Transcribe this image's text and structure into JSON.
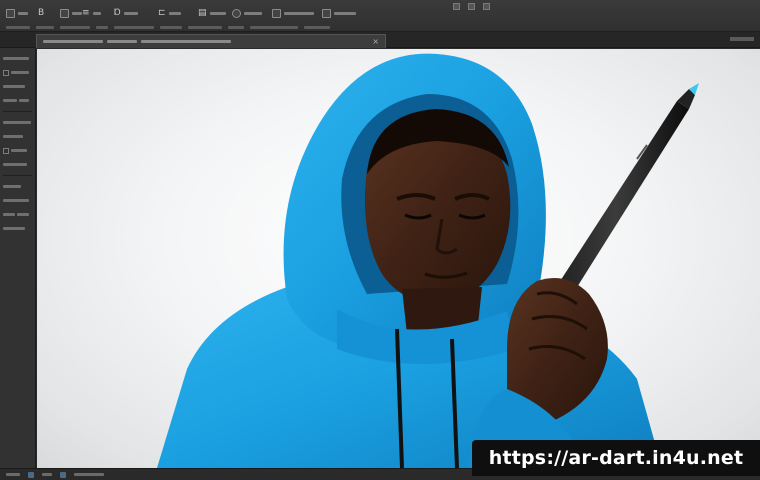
{
  "app": {
    "name": "image-editor",
    "accent": "#4a6a8a",
    "chrome_dark": "#2b2b2b",
    "canvas_bg": "#f2f3f4"
  },
  "menubar": {
    "tools": [
      {
        "icon": "square-dot-icon",
        "glyph": "◦"
      },
      {
        "icon": "bold-b-icon",
        "glyph": "B"
      },
      {
        "icon": "transform-icon",
        "glyph": "▫"
      },
      {
        "icon": "align-icon",
        "glyph": "≡"
      },
      {
        "icon": "pen-tip-icon",
        "glyph": "Ɒ"
      },
      {
        "icon": "ruler-icon",
        "glyph": "⊏"
      },
      {
        "icon": "layers-icon",
        "glyph": "▤"
      }
    ],
    "right_icons": [
      "grid-icon",
      "chevron-icon",
      "arrange-icon"
    ]
  },
  "document": {
    "tab_close_glyph": "×"
  },
  "canvas": {
    "subject": "person in blue hoodie holding stylus pen",
    "hoodie_color": "#1aa0e2",
    "stylus_tip_color": "#3cc6f0"
  },
  "watermark": {
    "text": "https://ar-dart.in4u.net"
  }
}
